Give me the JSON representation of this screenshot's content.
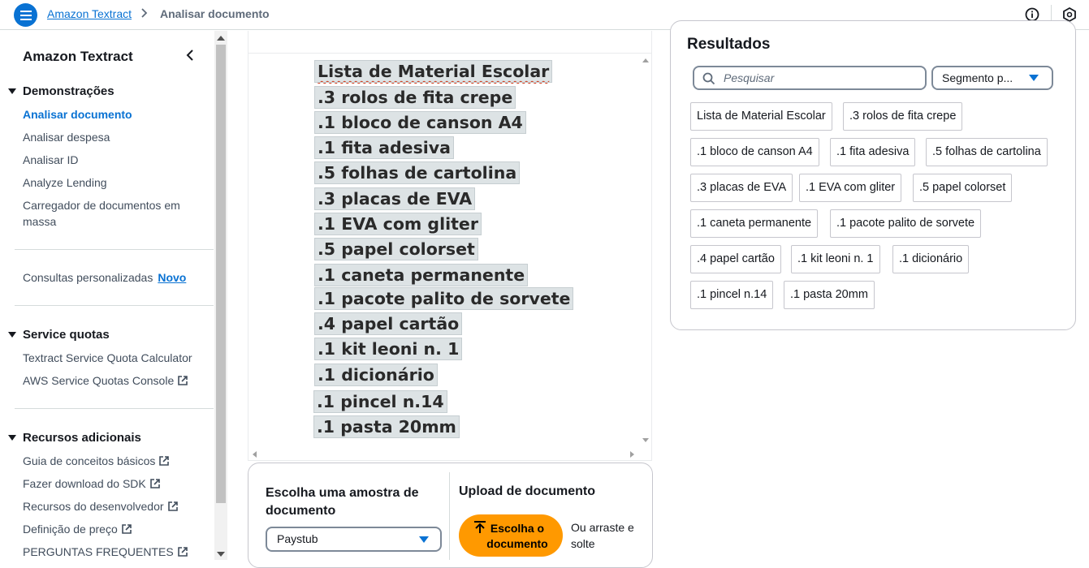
{
  "header": {
    "breadcrumb_root": "Amazon Textract",
    "breadcrumb_current": "Analisar documento"
  },
  "sidebar": {
    "title": "Amazon Textract",
    "sections": [
      {
        "label": "Demonstrações"
      },
      {
        "label": "Service quotas"
      },
      {
        "label": "Recursos adicionais"
      }
    ],
    "demo_items": [
      "Analisar documento",
      "Analisar despesa",
      "Analisar ID",
      "Analyze Lending",
      "Carregador de documentos em massa"
    ],
    "custom_queries": "Consultas personalizadas",
    "new_badge": "Novo",
    "quota_items": [
      "Textract Service Quota Calculator",
      "AWS Service Quotas Console"
    ],
    "resource_items": [
      "Guia de conceitos básicos",
      "Fazer download do SDK",
      "Recursos do desenvolvedor",
      "Definição de preço",
      "PERGUNTAS FREQUENTES"
    ]
  },
  "document": {
    "lines": [
      "Lista de Material Escolar",
      ".3 rolos de fita crepe",
      ".1 bloco de canson A4",
      ".1 fita adesiva",
      ".5 folhas de cartolina",
      ".3 placas de EVA",
      ".1 EVA com gliter",
      ".5 papel colorset",
      ".1 caneta permanente",
      ".1 pacote palito de sorvete",
      ".4 papel cartão",
      ".1 kit leoni n. 1",
      ".1 dicionário",
      ".1 pincel n.14",
      ".1 pasta 20mm"
    ]
  },
  "sample": {
    "title": "Escolha uma amostra de documento",
    "selected": "Paystub",
    "upload_title": "Upload de documento",
    "upload_button": "Escolha o documento",
    "drag_text": "Ou arraste e solte"
  },
  "results": {
    "title": "Resultados",
    "search_placeholder": "Pesquisar",
    "segment_label": "Segmento p...",
    "chips": [
      "Lista de Material Escolar",
      ".3 rolos de fita crepe",
      ".1 bloco de canson A4",
      ".1 fita adesiva",
      ".5 folhas de cartolina",
      ".3 placas de EVA",
      ".1 EVA com gliter",
      ".5 papel colorset",
      ".1 caneta permanente",
      ".1 pacote palito de sorvete",
      ".4 papel cartão",
      ".1 kit leoni n. 1",
      ".1 dicionário",
      ".1 pincel n.14",
      ".1 pasta 20mm"
    ]
  },
  "colors": {
    "accent": "#0972d3",
    "upload_button": "#ff9900"
  }
}
